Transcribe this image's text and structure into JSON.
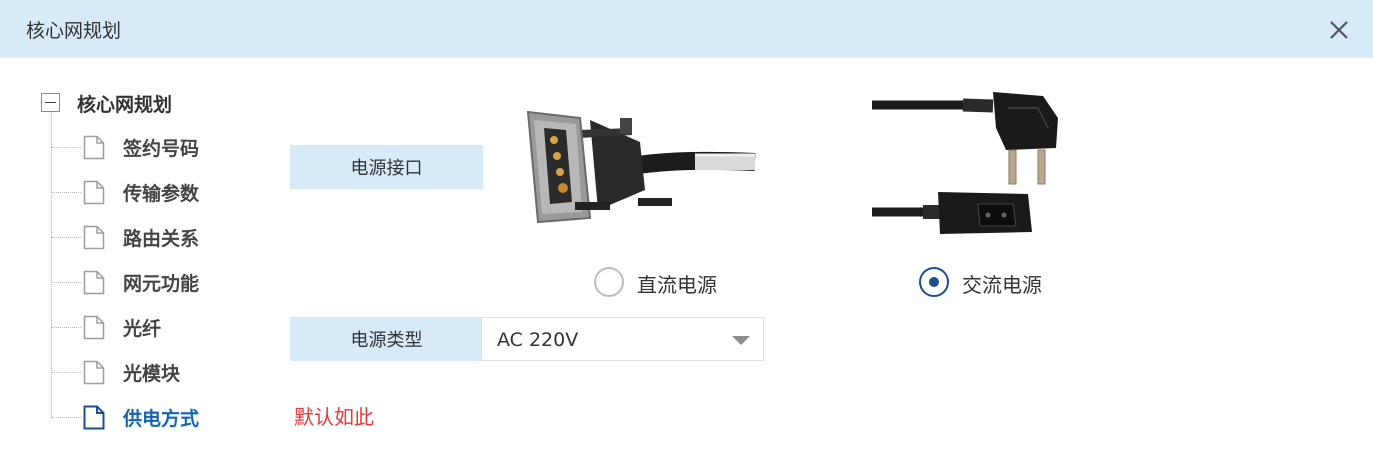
{
  "window": {
    "title": "核心网规划",
    "close_icon": "close-icon"
  },
  "tree": {
    "root": {
      "label": "核心网规划",
      "expanded": true
    },
    "items": [
      {
        "label": "签约号码",
        "active": false
      },
      {
        "label": "传输参数",
        "active": false
      },
      {
        "label": "路由关系",
        "active": false
      },
      {
        "label": "网元功能",
        "active": false
      },
      {
        "label": "光纤",
        "active": false
      },
      {
        "label": "光模块",
        "active": false
      },
      {
        "label": "供电方式",
        "active": true
      }
    ]
  },
  "power_interface": {
    "label": "电源接口",
    "options": [
      {
        "label": "直流电源",
        "selected": false,
        "image": "dc-power-connector"
      },
      {
        "label": "交流电源",
        "selected": true,
        "image": "ac-power-cord"
      }
    ]
  },
  "power_type": {
    "label": "电源类型",
    "selected": "AC 220V"
  },
  "note": "默认如此",
  "colors": {
    "header_bg": "#d6eaf8",
    "label_bg": "#d6eaf8",
    "active_tree": "#1565b0",
    "radio_checked": "#1a4e8c",
    "note": "#e03a3a"
  }
}
